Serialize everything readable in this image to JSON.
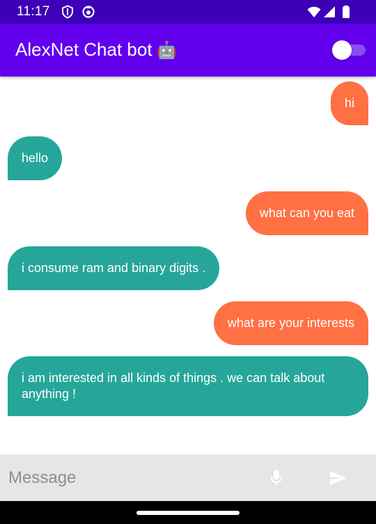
{
  "status_bar": {
    "time": "11:17",
    "left_icons": [
      "shield-icon",
      "sync-icon"
    ],
    "right_icons": [
      "wifi-icon",
      "cellular-icon",
      "battery-icon"
    ]
  },
  "app_bar": {
    "title": "AlexNet Chat bot",
    "title_emoji": "🤖",
    "toggle_on": true
  },
  "messages": [
    {
      "sender": "user",
      "text": "hi"
    },
    {
      "sender": "bot",
      "text": "hello"
    },
    {
      "sender": "user",
      "text": "what can you eat"
    },
    {
      "sender": "bot",
      "text": "i consume ram and binary digits ."
    },
    {
      "sender": "user",
      "text": "what are your interests"
    },
    {
      "sender": "bot",
      "text": "i am interested in all kinds of things . we can talk about anything !"
    }
  ],
  "composer": {
    "placeholder": "Message",
    "mic_icon": "mic-icon",
    "send_icon": "send-icon"
  },
  "colors": {
    "status_bar": "#3D00B8",
    "app_bar": "#6200EE",
    "user_bubble": "#FF7043",
    "bot_bubble": "#26A69A",
    "composer_bg": "#E6E6E6"
  }
}
